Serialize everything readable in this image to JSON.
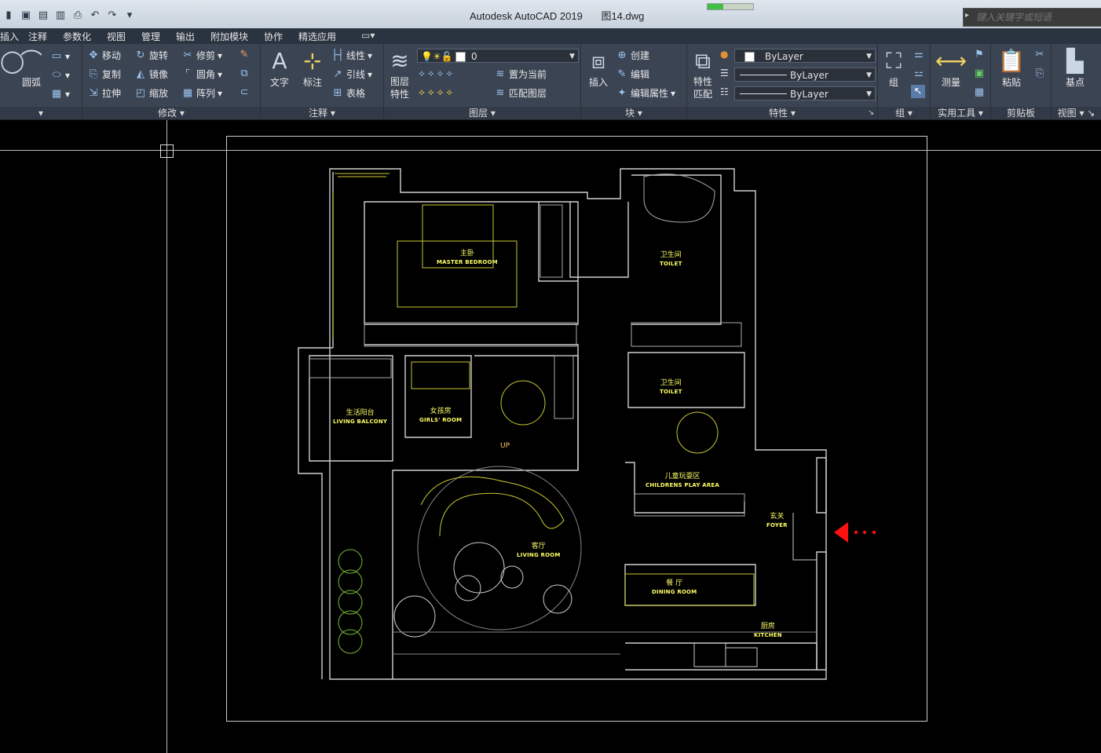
{
  "window": {
    "app_title": "Autodesk AutoCAD 2019",
    "file_name": "图14.dwg",
    "search_placeholder": "键入关键字或短语",
    "load_progress": 0.35
  },
  "qat_icons": [
    "drawing-icon",
    "save-icon",
    "save-as-icon",
    "publish-icon",
    "print-icon",
    "undo-icon",
    "redo-icon",
    "more-icon"
  ],
  "menu": [
    "插入",
    "注释",
    "参数化",
    "视图",
    "管理",
    "输出",
    "附加模块",
    "协作",
    "精选应用"
  ],
  "ribbon": {
    "draw": {
      "arc_label": "圆弧"
    },
    "modify": {
      "title": "修改",
      "tools": [
        "移动",
        "旋转",
        "修剪",
        "复制",
        "镜像",
        "圆角",
        "拉伸",
        "缩放",
        "阵列"
      ]
    },
    "annotation": {
      "title": "注释",
      "text_label": "文字",
      "dim_label": "标注",
      "tools": [
        "线性",
        "引线",
        "表格"
      ]
    },
    "layers": {
      "title": "图层",
      "props_label_1": "图层",
      "props_label_2": "特性",
      "current_layer": "0",
      "tools": [
        "置为当前",
        "匹配图层"
      ]
    },
    "block": {
      "title": "块",
      "insert_label": "插入",
      "tools": [
        "创建",
        "编辑",
        "编辑属性"
      ]
    },
    "properties": {
      "title": "特性",
      "match_label_1": "特性",
      "match_label_2": "匹配",
      "color": "ByLayer",
      "linetype": "ByLayer",
      "lineweight": "ByLayer"
    },
    "groups": {
      "title": "组",
      "group_label": "组"
    },
    "utilities": {
      "title": "实用工具",
      "measure_label": "测量"
    },
    "clipboard": {
      "title": "剪贴板",
      "paste_label": "粘贴"
    },
    "view": {
      "title": "视图",
      "base_label": "基点"
    }
  },
  "drawing": {
    "rooms": [
      {
        "cn": "主卧",
        "en": "MASTER BEDROOM"
      },
      {
        "cn": "卫生间",
        "en": "TOILET"
      },
      {
        "cn": "卫生间",
        "en": "TOILET"
      },
      {
        "cn": "生活阳台",
        "en": "LIVING BALCONY"
      },
      {
        "cn": "女孩房",
        "en": "GIRLS' ROOM"
      },
      {
        "cn": "儿童玩耍区",
        "en": "CHILDRENS  PLAY AREA"
      },
      {
        "cn": "玄关",
        "en": "FOYER"
      },
      {
        "cn": "客厅",
        "en": "LIVING ROOM"
      },
      {
        "cn": "餐 厅",
        "en": "DINING ROOM"
      },
      {
        "cn": "厨房",
        "en": "KITCHEN"
      }
    ],
    "stair_label": "UP",
    "colors": {
      "wall": "#cccccc",
      "furniture": "#c8c832",
      "label": "#ffff66",
      "entry_arrow": "#ff1010"
    }
  }
}
